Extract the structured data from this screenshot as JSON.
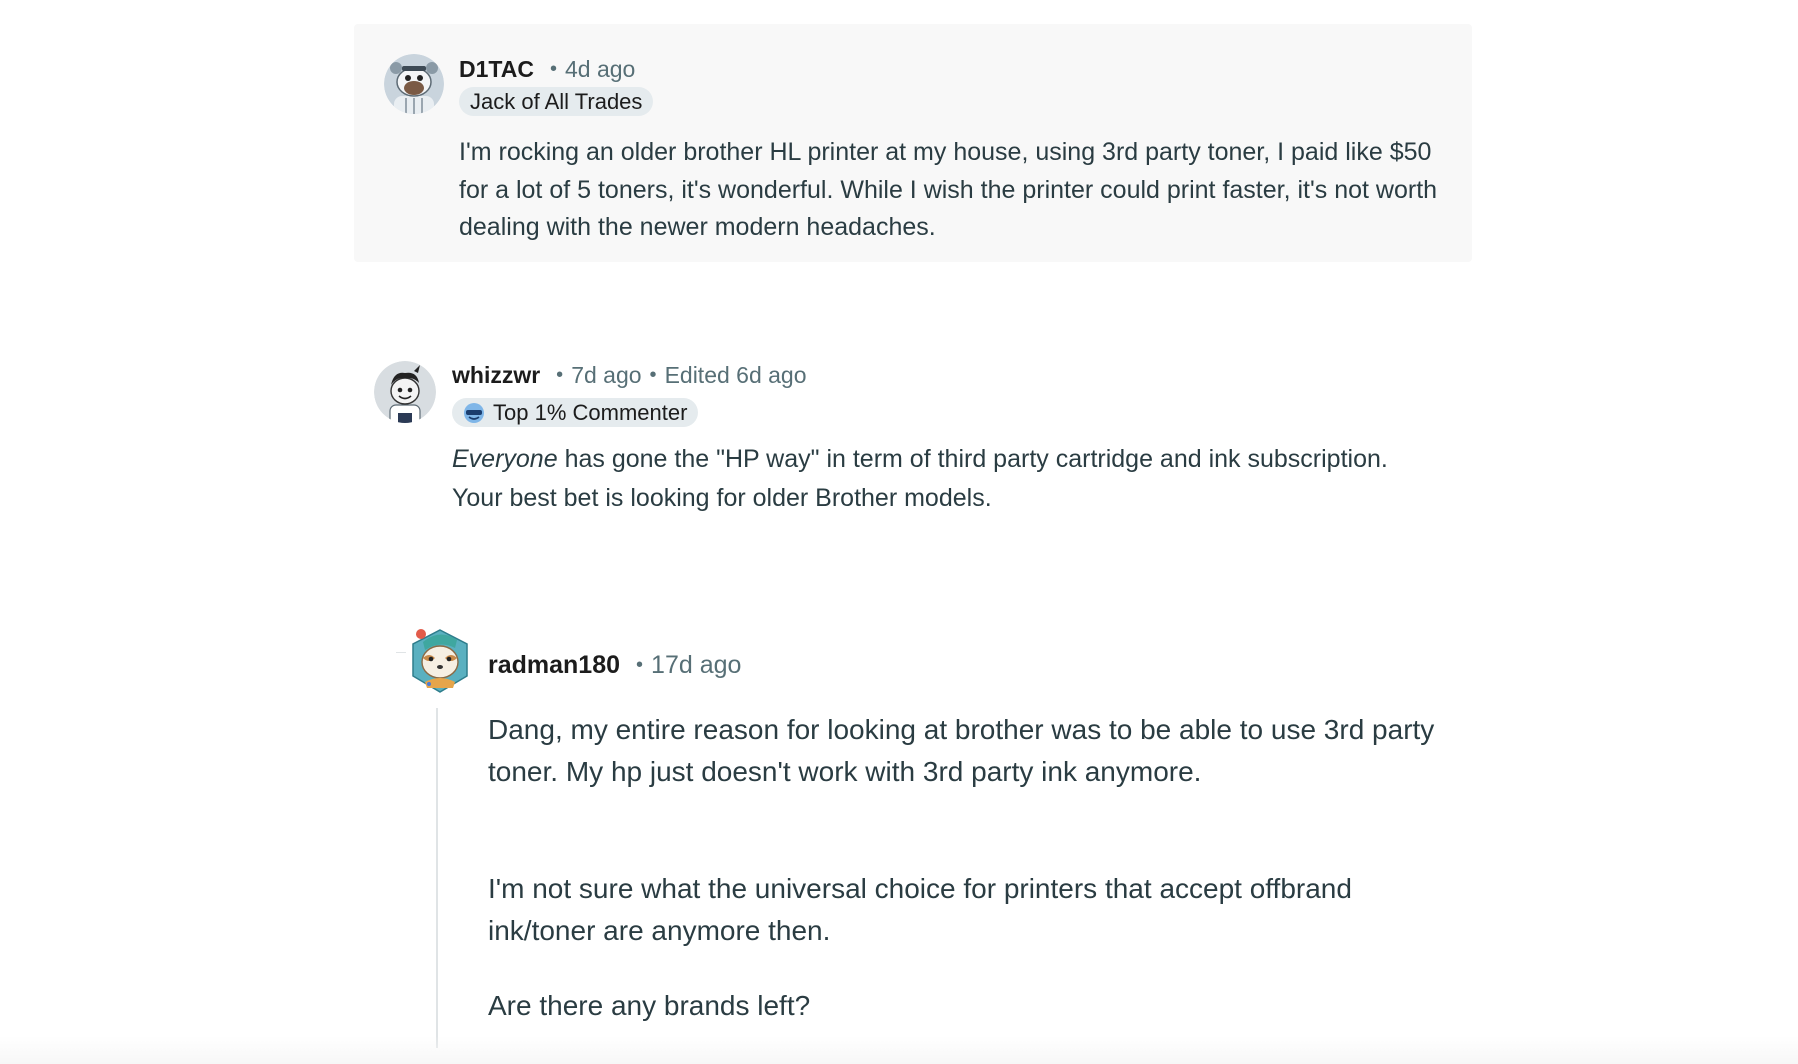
{
  "comments": [
    {
      "username": "D1TAC",
      "separator": "•",
      "age": "4d ago",
      "flair": "Jack of All Trades",
      "body": "I'm rocking an older brother HL printer at my house, using 3rd party toner, I paid like $50 for a lot of 5 toners, it's wonderful. While I wish the printer could print faster, it's not worth dealing with the newer modern headaches.",
      "avatar_icon": "snoo-avatar-icon"
    },
    {
      "username": "whizzwr",
      "separator": "•",
      "age": "7d ago",
      "separator2": "•",
      "edited": "Edited 6d ago",
      "flair": "Top 1% Commenter",
      "flair_icon": "top-commenter-icon",
      "body_emphasis": "Everyone",
      "body_rest": " has gone the \"HP way\" in term of third party cartridge and ink subscription. Your best bet is looking for older Brother models.",
      "avatar_icon": "snoo-avatar-icon"
    },
    {
      "username": "radman180",
      "separator": "•",
      "age": "17d ago",
      "paragraphs": [
        "Dang, my entire reason for looking at brother was to be able to use 3rd party toner. My hp just doesn't work with 3rd party ink anymore.",
        "I'm not sure what the universal choice for printers that accept offbrand ink/toner are anymore then.",
        "Are there any brands left?"
      ],
      "avatar_icon": "snoo-avatar-icon"
    }
  ],
  "colors": {
    "card_bg": "#f8f8f8",
    "flair_bg": "#e5ebee",
    "meta_text": "#576f76",
    "body_text": "#2a3c42",
    "thread_line": "#e0e4e6"
  }
}
